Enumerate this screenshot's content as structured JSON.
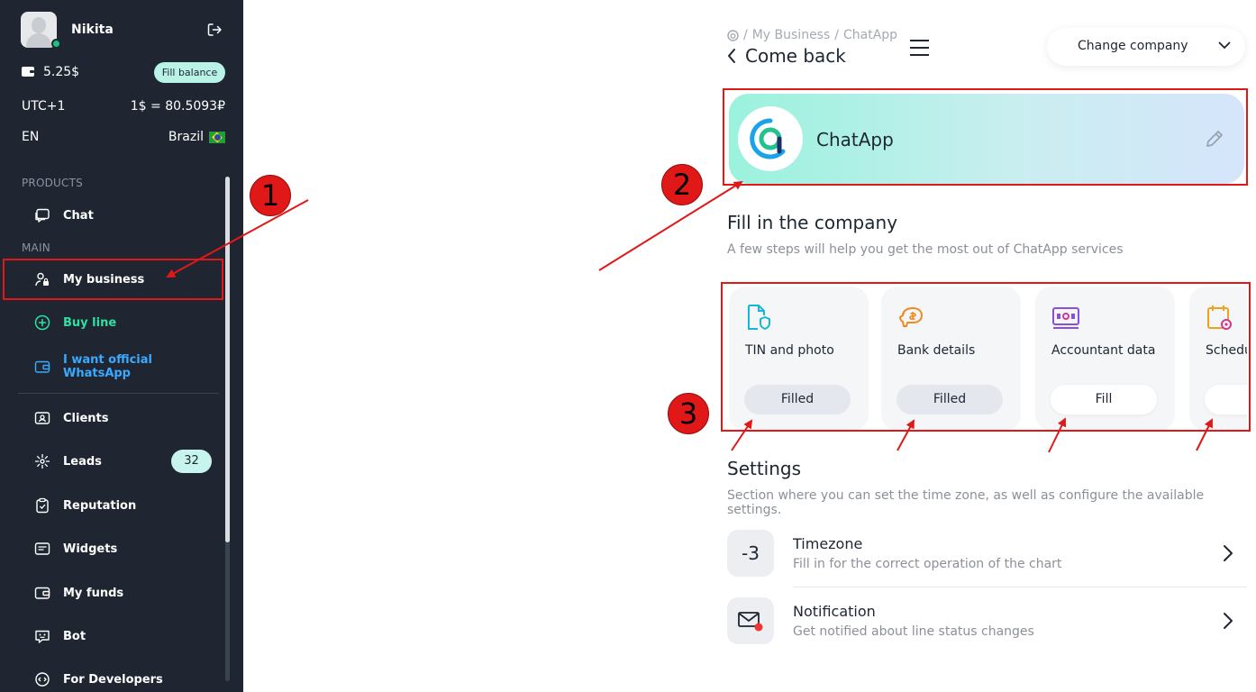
{
  "user": {
    "name": "Nikita",
    "balance": "5.25$",
    "fill_balance": "Fill balance"
  },
  "locale": {
    "timezone": "UTC+1",
    "rate": "1$ = 80.5093₽",
    "language": "EN",
    "country": "Brazil"
  },
  "sidebar": {
    "products_label": "PRODUCTS",
    "main_label": "MAIN",
    "items": [
      {
        "label": "Chat",
        "icon": "chat-icon"
      },
      {
        "label": "My business",
        "icon": "user-lock-icon"
      },
      {
        "label": "Buy line",
        "icon": "plus-circle-icon"
      },
      {
        "label": "I want official WhatsApp",
        "icon": "wallet-icon"
      },
      {
        "label": "Clients",
        "icon": "contact-card-icon"
      },
      {
        "label": "Leads",
        "icon": "leads-icon",
        "badge": "32"
      },
      {
        "label": "Reputation",
        "icon": "clipboard-icon"
      },
      {
        "label": "Widgets",
        "icon": "widget-icon"
      },
      {
        "label": "My funds",
        "icon": "funds-icon"
      },
      {
        "label": "Bot",
        "icon": "bot-icon"
      },
      {
        "label": "For Developers",
        "icon": "developers-icon"
      }
    ]
  },
  "header": {
    "breadcrumb": [
      "My Business",
      "ChatApp"
    ],
    "back_label": "Come back",
    "company_select": "Change company"
  },
  "company": {
    "name": "ChatApp"
  },
  "fill_section": {
    "title": "Fill in the company",
    "subtitle": "A few steps will help you get the most out of ChatApp services",
    "steps": [
      {
        "title": "TIN and photo",
        "button": "Filled",
        "status": "filled",
        "icon": "document-shield-icon"
      },
      {
        "title": "Bank details",
        "button": "Filled",
        "status": "filled",
        "icon": "piggy-bank-icon"
      },
      {
        "title": "Accountant data",
        "button": "Fill",
        "status": "empty",
        "icon": "id-card-icon"
      },
      {
        "title": "Schedule",
        "button": "",
        "status": "empty",
        "icon": "calendar-gear-icon"
      }
    ]
  },
  "settings_section": {
    "title": "Settings",
    "subtitle": "Section where you can set the time zone, as well as configure the available settings.",
    "rows": [
      {
        "badge": "-3",
        "title": "Timezone",
        "desc": "Fill in for the correct operation of the chart"
      },
      {
        "title": "Notification",
        "desc": "Get notified about line status changes",
        "icon": "mail-alert-icon"
      }
    ]
  },
  "annotations": [
    "1",
    "2",
    "3"
  ],
  "colors": {
    "sidebar_bg": "#1f2631",
    "accent_green": "#2fe0a1",
    "accent_blue": "#3aa9ff",
    "annotation_red": "#e01818"
  }
}
